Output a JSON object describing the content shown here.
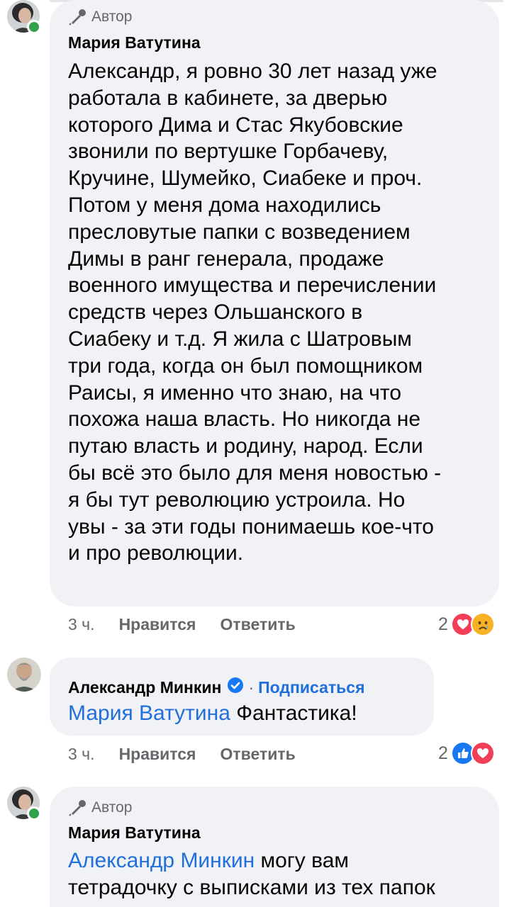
{
  "comments": [
    {
      "author_badge": "Автор",
      "name": "Мария Ватутина",
      "text": "Александр, я ровно 30 лет назад уже\nработала в кабинете, за дверью\nкоторого Дима и Стас Якубовские\nзвонили по вертушке Горбачеву,\nКручине, Шумейко, Сиабеке и проч.\nПотом у меня дома находились\nпресловутые папки с возведением\nДимы в ранг генерала, продаже\nвоенного имущества и перечислении\nсредств через Ольшанского в\nСиабеку и т.д. Я жила с Шатровым\nтри года, когда он был помощником\nРаисы, я именно что знаю, на что\nпохожа наша власть. Но никогда не\nпутаю власть и родину, народ. Если\nбы всё это было для меня новостью -\nя бы тут революцию устроила. Но\nувы - за эти годы понимаешь кое-что\nи про революции.",
      "time": "3 ч.",
      "like": "Нравится",
      "reply": "Ответить",
      "reaction_count": "2",
      "reactions": [
        "heart-icon",
        "sad-icon"
      ]
    },
    {
      "name": "Александр Минкин",
      "subscribe": "Подписаться",
      "separator": "·",
      "mention": "Мария Ватутина",
      "text": " Фантастика!",
      "time": "3 ч.",
      "like": "Нравится",
      "reply": "Ответить",
      "reaction_count": "2",
      "reactions": [
        "like-icon",
        "heart-icon"
      ]
    },
    {
      "author_badge": "Автор",
      "name": "Мария Ватутина",
      "mention": "Александр Минкин",
      "text_line1": " могу вам",
      "text_line2": "тетрадочку с выписками из тех папок"
    }
  ],
  "colors": {
    "bubble": "#f0f2f5",
    "link": "#216fdb",
    "meta": "#65676b",
    "online": "#31a24c",
    "like_blue": "#1877f2",
    "heart_red": "#f33e58",
    "sad_yellow": "#f7b125"
  }
}
